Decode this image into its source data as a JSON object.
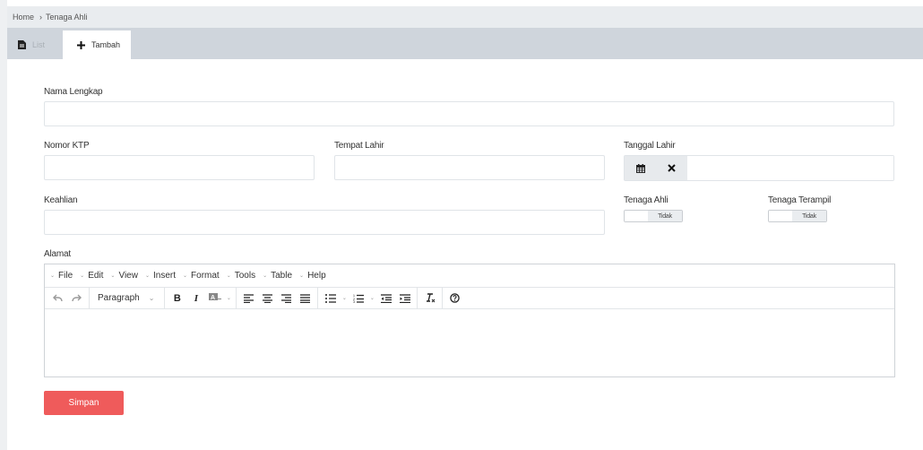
{
  "breadcrumb": {
    "home": "Home",
    "separator": "›",
    "current": "Tenaga Ahli"
  },
  "tabs": [
    {
      "label": "List",
      "icon": "file-icon",
      "active": false
    },
    {
      "label": "Tambah",
      "icon": "plus-icon",
      "active": true
    }
  ],
  "form": {
    "nama_lengkap": {
      "label": "Nama Lengkap",
      "value": ""
    },
    "nomor_ktp": {
      "label": "Nomor KTP",
      "value": ""
    },
    "tempat_lahir": {
      "label": "Tempat Lahir",
      "value": ""
    },
    "tanggal_lahir": {
      "label": "Tanggal Lahir",
      "value": "",
      "calendar_icon": "calendar-icon",
      "clear_icon": "close-icon"
    },
    "keahlian": {
      "label": "Keahlian",
      "value": ""
    },
    "tenaga_ahli": {
      "label": "Tenaga Ahli",
      "toggle_state": "Tidak"
    },
    "tenaga_terampil": {
      "label": "Tenaga Terampil",
      "toggle_state": "Tidak"
    },
    "alamat": {
      "label": "Alamat",
      "value": ""
    }
  },
  "editor": {
    "menus": [
      "File",
      "Edit",
      "View",
      "Insert",
      "Format",
      "Tools",
      "Table",
      "Help"
    ],
    "block_format": "Paragraph"
  },
  "submit_label": "Simpan",
  "colors": {
    "accent": "#ef5b5b",
    "tabbar": "#cfd5dc",
    "breadcrumb": "#e9ecef"
  }
}
